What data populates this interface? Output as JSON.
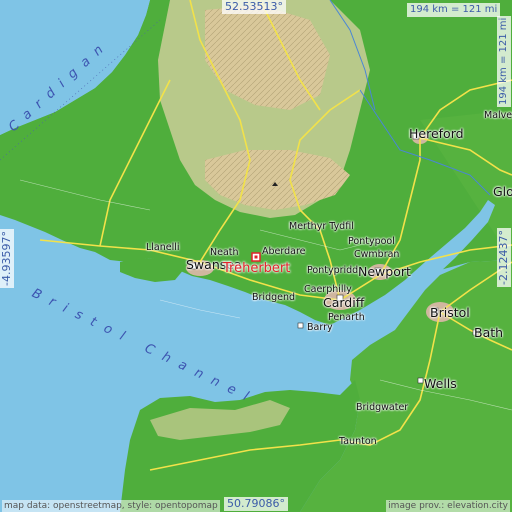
{
  "map": {
    "highlight": "Treherbert",
    "coords": {
      "top": "52.53513°",
      "bottom": "50.79086°",
      "left": "-4.93597°",
      "right": "-2.12437°"
    },
    "scale": {
      "top": "194 km = 121 mi",
      "right": "194 km = 121 mi"
    },
    "water_labels": {
      "cardigan": "Cardigan",
      "bristol_channel": "Bristol Channel"
    },
    "places": {
      "hereford": "Hereford",
      "malvern": "Malvern",
      "gloucester": "Glo",
      "merthyr": "Merthyr Tydfil",
      "aberdare": "Aberdare",
      "neath": "Neath",
      "swansea": "Swansea",
      "llanelli": "Llanelli",
      "pontypool": "Pontypool",
      "cwmbran": "Cwmbran",
      "pontypridd": "Pontypridd",
      "newport": "Newport",
      "caerphilly": "Caerphilly",
      "bridgend": "Bridgend",
      "cardiff": "Cardiff",
      "penarth": "Penarth",
      "barry": "Barry",
      "bristol": "Bristol",
      "bath": "Bath",
      "wells": "Wells",
      "bridgwater": "Bridgwater",
      "taunton": "Taunton"
    },
    "attribution_left": "map data: openstreetmap, style: opentopomap",
    "attribution_right": "image prov.: elevation.city",
    "colors": {
      "sea": "#7fc4e6",
      "lowland": "#4fae3c",
      "upland": "#b8c98a",
      "highland": "#d9c89a",
      "road": "#f2e24a",
      "highlight": "#e1242b"
    }
  }
}
